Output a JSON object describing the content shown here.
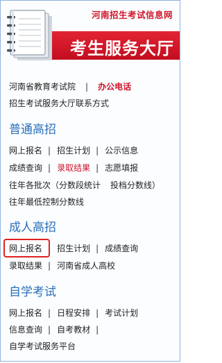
{
  "header": {
    "site_name": "河南招生考试信息网",
    "hall_title": "考生服务大厅"
  },
  "contact": {
    "org": "河南省教育考试院",
    "office_phone": "办公电话",
    "hall_contact": "招生考试服务大厅联系方式"
  },
  "general": {
    "title": "普通高招",
    "online_signup": "网上报名",
    "enroll_plan": "招生计划",
    "public_info": "公示信息",
    "score_query": "成绩查询",
    "admission_result": "录取结果",
    "volunteer_fill": "志愿填报",
    "past_batches": "往年各批次（分数段统计",
    "investment_line": "投档分数线）",
    "past_min_lines": "往年最低控制分数线"
  },
  "adult": {
    "title": "成人高招",
    "online_signup": "网上报名",
    "enroll_plan": "招生计划",
    "score_query": "成绩查询",
    "admission_result": "录取结果",
    "adult_colleges": "河南省成人高校"
  },
  "self_study": {
    "title": "自学考试",
    "online_signup": "网上报名",
    "schedule": "日程安排",
    "exam_plan": "考试计划",
    "info_query": "信息查询",
    "textbooks": "自考教材",
    "service_platform": "自学考试服务平台"
  },
  "separator": "|",
  "colors": {
    "brand_red": "#d0152a",
    "section_blue": "#2a6fba",
    "highlight_red": "#e0201e"
  }
}
